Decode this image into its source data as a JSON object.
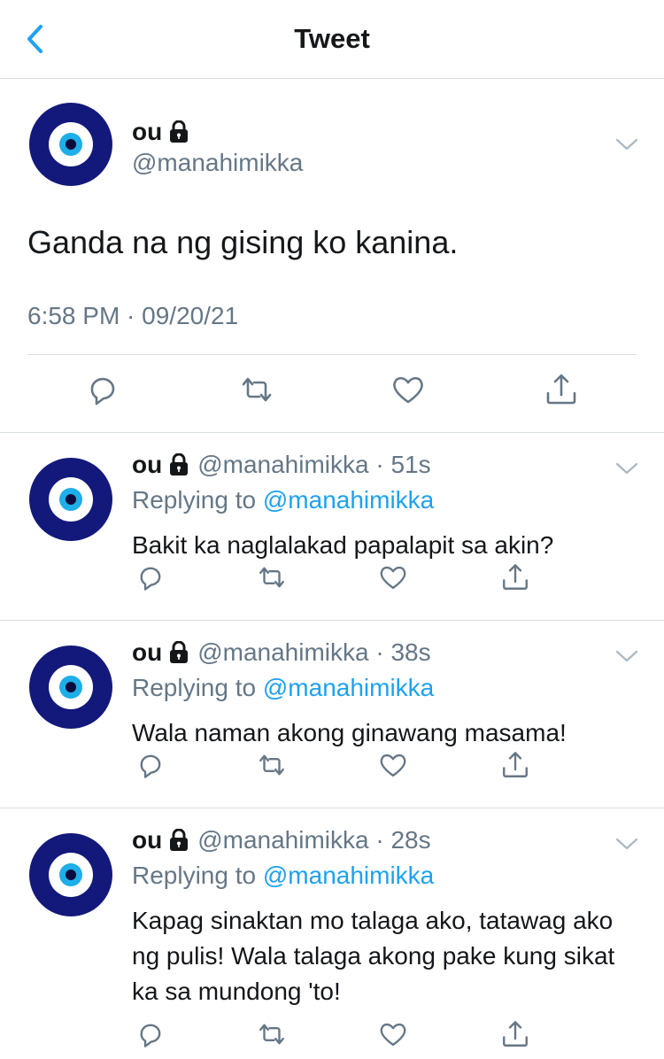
{
  "header": {
    "title": "Tweet",
    "back_icon": "chevron-left-icon"
  },
  "colors": {
    "accent": "#1da1f2",
    "secondary_text": "#657786",
    "avatar_dark": "#13197a",
    "avatar_iris": "#1eaee8"
  },
  "main_tweet": {
    "name": "ou",
    "handle": "@manahimikka",
    "text": "Ganda na ng gising ko kanina.",
    "meta": "6:58 PM · 09/20/21"
  },
  "replies": [
    {
      "name": "ou",
      "handle": "@manahimikka · 51s",
      "replying_prefix": "Replying to ",
      "replying_to": "@manahimikka",
      "text": "Bakit ka naglalakad papalapit sa akin?"
    },
    {
      "name": "ou",
      "handle": "@manahimikka · 38s",
      "replying_prefix": "Replying to ",
      "replying_to": "@manahimikka",
      "text": "Wala naman akong ginawang masama!"
    },
    {
      "name": "ou",
      "handle": "@manahimikka · 28s",
      "replying_prefix": "Replying to ",
      "replying_to": "@manahimikka",
      "text": "Kapag sinaktan mo talaga ako, tatawag ako ng pulis! Wala talaga akong pake kung sikat ka sa mundong 'to!"
    }
  ],
  "action_icons": [
    "reply-icon",
    "retweet-icon",
    "like-icon",
    "share-icon"
  ]
}
